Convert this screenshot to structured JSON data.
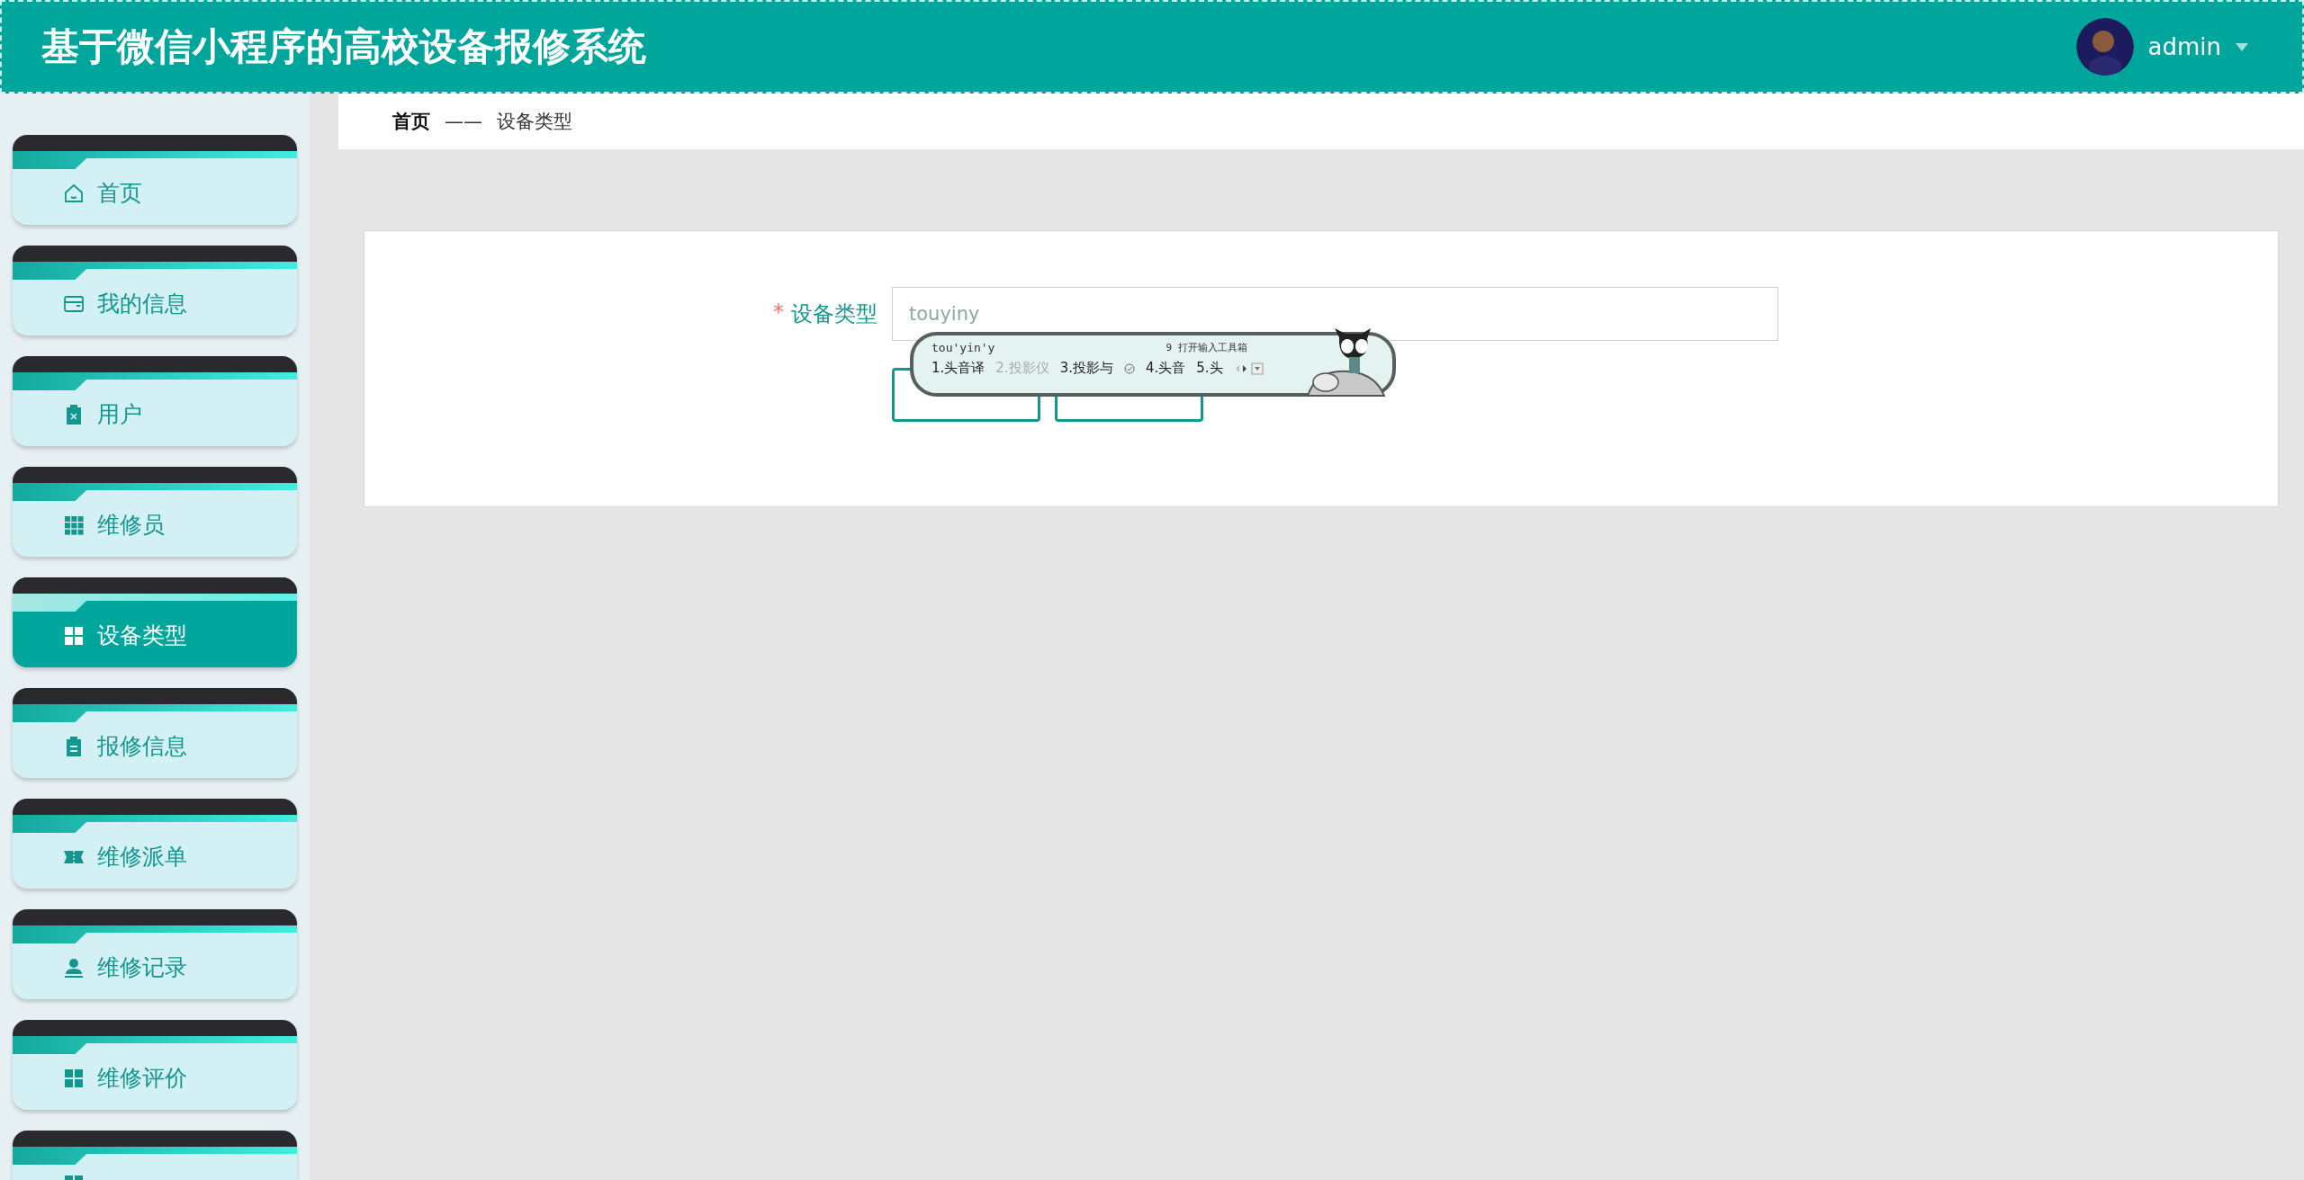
{
  "header": {
    "title": "基于微信小程序的高校设备报修系统",
    "user": {
      "name": "admin"
    }
  },
  "sidebar": {
    "items": [
      {
        "label": "首页",
        "kind": "home",
        "selected": false
      },
      {
        "label": "我的信息",
        "kind": "wallet",
        "selected": false
      },
      {
        "label": "用户",
        "kind": "clipboard-x",
        "selected": false
      },
      {
        "label": "维修员",
        "kind": "grid9",
        "selected": false
      },
      {
        "label": "设备类型",
        "kind": "grid4",
        "selected": true
      },
      {
        "label": "报修信息",
        "kind": "clipboard",
        "selected": false
      },
      {
        "label": "维修派单",
        "kind": "ticket",
        "selected": false
      },
      {
        "label": "维修记录",
        "kind": "person",
        "selected": false
      },
      {
        "label": "维修评价",
        "kind": "grid4",
        "selected": false
      },
      {
        "kind": "grid4",
        "selected": false
      }
    ]
  },
  "breadcrumb": [
    {
      "label": "首页",
      "current": false
    },
    {
      "label": "设备类型",
      "current": true
    }
  ],
  "breadcrumb_separator": "——",
  "form": {
    "fields": [
      {
        "label": "设备类型",
        "required_mark": "*",
        "value": "touyiny"
      }
    ],
    "buttons": [
      {
        "kind": "outline"
      },
      {
        "kind": "outline"
      }
    ]
  },
  "ime": {
    "composition": "tou'yin'y",
    "tool_hint": "9 打开输入工具箱",
    "candidates": [
      {
        "text": "1.头音译",
        "dimmed": false
      },
      {
        "text": "2.投影仪",
        "dimmed": true
      },
      {
        "text": "3.投影与",
        "dimmed": false
      },
      {
        "text": "4.头音",
        "dimmed": false
      },
      {
        "text": "5.头",
        "dimmed": false
      }
    ]
  }
}
